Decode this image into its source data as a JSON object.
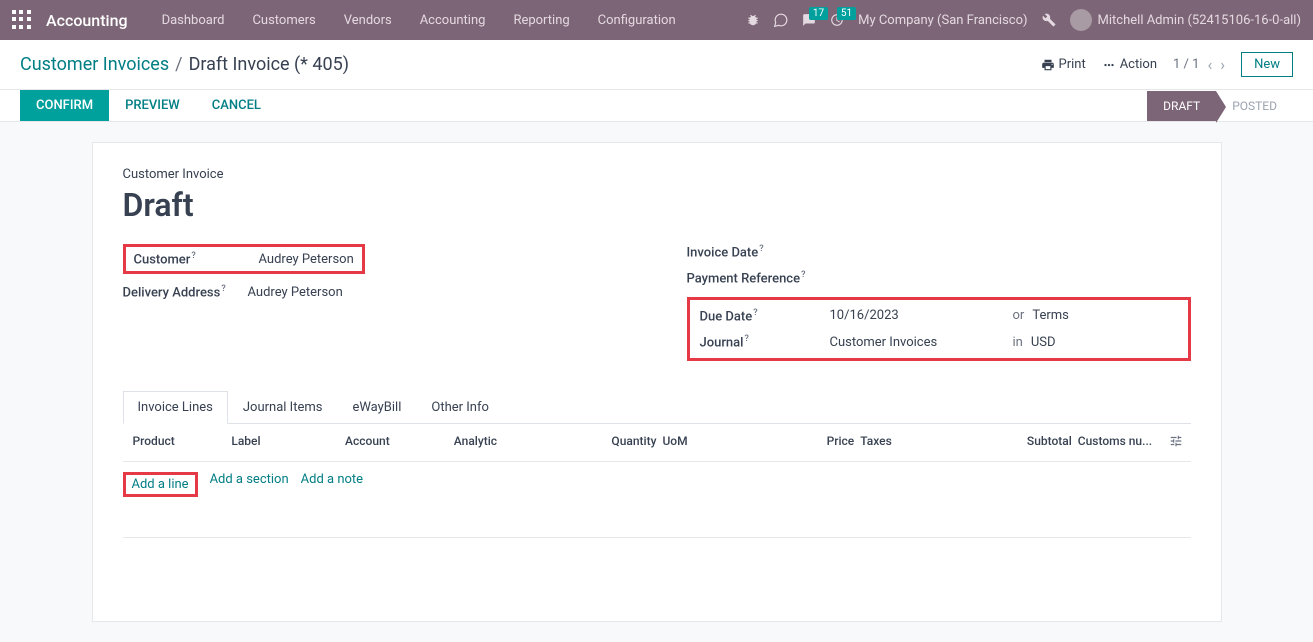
{
  "nav": {
    "app_name": "Accounting",
    "links": [
      "Dashboard",
      "Customers",
      "Vendors",
      "Accounting",
      "Reporting",
      "Configuration"
    ],
    "chat_badge": "17",
    "activity_badge": "51",
    "company": "My Company (San Francisco)",
    "user": "Mitchell Admin (52415106-16-0-all)"
  },
  "breadcrumb": {
    "parent": "Customer Invoices",
    "current": "Draft Invoice (* 405)"
  },
  "controls": {
    "print": "Print",
    "action": "Action",
    "pager": "1 / 1",
    "new": "New"
  },
  "actions": {
    "confirm": "CONFIRM",
    "preview": "PREVIEW",
    "cancel": "CANCEL"
  },
  "status": {
    "draft": "DRAFT",
    "posted": "POSTED"
  },
  "form": {
    "subtitle": "Customer Invoice",
    "title": "Draft",
    "customer_label": "Customer",
    "customer_value": "Audrey Peterson",
    "delivery_label": "Delivery Address",
    "delivery_value": "Audrey Peterson",
    "invoice_date_label": "Invoice Date",
    "payment_ref_label": "Payment Reference",
    "due_date_label": "Due Date",
    "due_date_value": "10/16/2023",
    "due_date_or": "or",
    "due_date_terms": "Terms",
    "journal_label": "Journal",
    "journal_value": "Customer Invoices",
    "journal_in": "in",
    "journal_currency": "USD"
  },
  "tabs": [
    "Invoice Lines",
    "Journal Items",
    "eWayBill",
    "Other Info"
  ],
  "table": {
    "headers": {
      "product": "Product",
      "label": "Label",
      "account": "Account",
      "analytic": "Analytic",
      "quantity": "Quantity",
      "uom": "UoM",
      "price": "Price",
      "taxes": "Taxes",
      "subtotal": "Subtotal",
      "customs": "Customs nu..."
    },
    "add_line": "Add a line",
    "add_section": "Add a section",
    "add_note": "Add a note"
  }
}
